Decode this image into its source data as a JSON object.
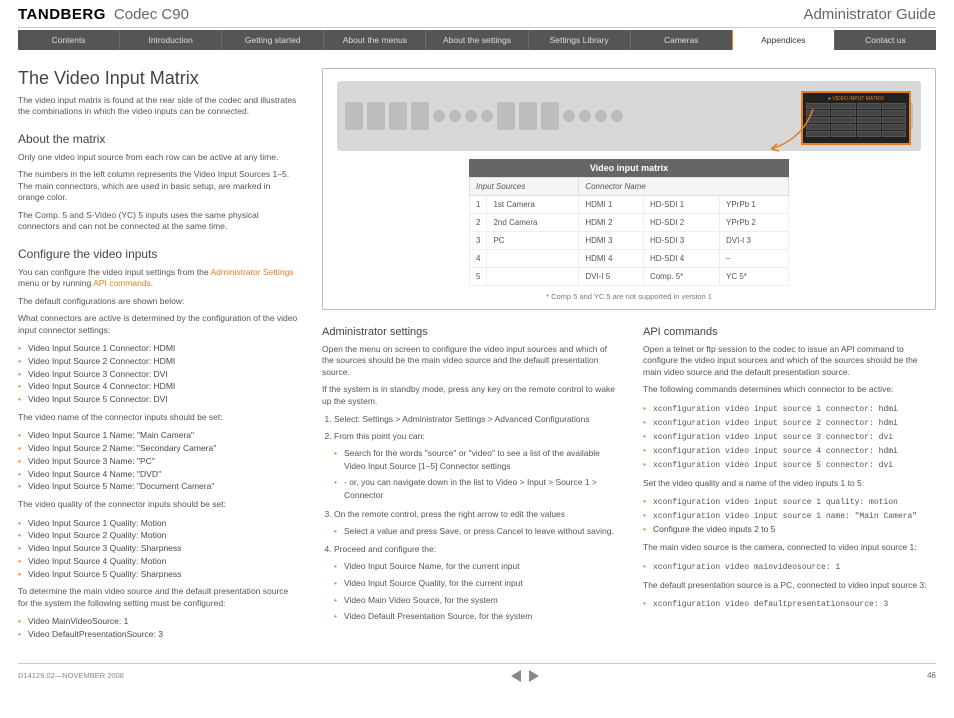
{
  "header": {
    "brand": "TANDBERG",
    "model": "Codec C90",
    "guide": "Administrator Guide"
  },
  "nav": [
    "Contents",
    "Introduction",
    "Getting started",
    "About the menus",
    "About the settings",
    "Settings Library",
    "Cameras",
    "Appendices",
    "Contact us"
  ],
  "nav_active": "Appendices",
  "page": {
    "title": "The Video Input Matrix",
    "intro": "The video input matrix is found at the rear side of the codec and illustrates the combinations in which the video inputs can be connected.",
    "about_h": "About the matrix",
    "about_p1": "Only one video input source from each row can be active at any time.",
    "about_p2": "The numbers in the left column represents the Video Input Sources 1–5. The main connectors, which are used in basic setup, are marked in orange color.",
    "about_p3": "The Comp. 5 and S-Video (YC) 5 inputs uses the same physical connectors and can not be connected at the same time.",
    "config_h": "Configure the video inputs",
    "config_p1_a": "You can configure the video input settings from the ",
    "config_p1_link1": "Administrator Settings",
    "config_p1_b": " menu or by running ",
    "config_p1_link2": "API commands",
    "config_p1_c": ".",
    "config_p2": "The default configurations are shown below:",
    "config_p3": "What connectors are active is determined by the configuration of the video input connector settings:",
    "connectors": [
      "Video Input Source 1 Connector: HDMI",
      "Video Input Source 2 Connector: HDMI",
      "Video Input Source 3 Connector: DVI",
      "Video Input Source 4 Connector: HDMI",
      "Video Input Source 5 Connector: DVI"
    ],
    "names_intro": "The video name of the connector inputs should be set:",
    "names": [
      "Video Input Source 1 Name: \"Main Camera\"",
      "Video Input Source 2 Name: \"Secondary Camera\"",
      "Video Input Source 3 Name: \"PC\"",
      "Video Input Source 4 Name: \"DVD\"",
      "Video Input Source 5 Name: \"Document Camera\""
    ],
    "quality_intro": "The video quality of the connector inputs should be set:",
    "quality": [
      "Video Input Source 1 Quality: Motion",
      "Video Input Source 2 Quality: Motion",
      "Video Input Source 3 Quality: Sharpness",
      "Video Input Source 4 Quality: Motion",
      "Video Input Source 5 Quality: Sharpness"
    ],
    "determine_intro": "To determine the main video source and the default presentation source for the system the following setting must be configured:",
    "determine": [
      "Video MainVideoSource: 1",
      "Video DefaultPresentationSource: 3"
    ]
  },
  "matrix": {
    "title": "Video input matrix",
    "col1": "Input Sources",
    "col2": "Connector Name",
    "rows": [
      {
        "n": "1",
        "src": "1st Camera",
        "c1": "HDMI 1",
        "c2": "HD-SDI 1",
        "c3": "YPrPb 1",
        "hl": true
      },
      {
        "n": "2",
        "src": "2nd Camera",
        "c1": "HDMI 2",
        "c2": "HD-SDI 2",
        "c3": "YPrPb 2",
        "hl": false
      },
      {
        "n": "3",
        "src": "PC",
        "c1": "HDMI 3",
        "c2": "HD-SDI 3",
        "c3": "DVI-I 3",
        "hl": true,
        "hl3": true
      },
      {
        "n": "4",
        "src": "",
        "c1": "HDMI 4",
        "c2": "HD-SDI 4",
        "c3": "–",
        "hl": false
      },
      {
        "n": "5",
        "src": "",
        "c1": "DVI-I 5",
        "c2": "Comp. 5*",
        "c3": "YC 5*",
        "hl": false
      }
    ],
    "footnote": "* Comp 5 and YC 5  are not supported in version 1"
  },
  "admin": {
    "h": "Administrator settings",
    "p1": "Open the menu on screen to configure the video input sources and which of the sources should be the main video source and the default presentation source.",
    "p2": "If the system is in standby mode, press any key on the remote control to wake up the system.",
    "steps": {
      "s1": "Select: Settings > Administrator Settings > Advanced Configurations",
      "s2": "From this point you can:",
      "s2a": "Search for the words \"source\" or \"video\" to see a list of the available Video Input Source [1–5] Connector settings",
      "s2b": "- or, you can navigate down in the list to Video > Input > Source 1 > Connector",
      "s3": "On the remote control, press the right arrow to edit the values",
      "s3a": "Select a value and press Save, or press Cancel to leave without saving.",
      "s4": "Proceed and configure the:",
      "s4list": [
        "Video Input Source Name, for the current input",
        "Video Input Source Quality, for the current input",
        "Video Main Video Source, for the system",
        "Video Default Presentation Source, for the system"
      ]
    }
  },
  "api": {
    "h": "API commands",
    "p1": "Open a telnet or ftp session to the codec to issue an API command to configure the video input sources and which of the sources should be the main video source and the default presentation source.",
    "p2": "The following commands determines which connector to be active:",
    "cmds1": [
      "xconfiguration video input source 1 connector: hdmi",
      "xconfiguration video input source 2 connector: hdmi",
      "xconfiguration video input source 3 connector: dvi",
      "xconfiguration video input source 4 connector: hdmi",
      "xconfiguration video input source 5 connector: dvi"
    ],
    "p3": "Set the video quality and a name of the video inputs 1 to 5:",
    "cmds2": [
      "xconfiguration video input source 1 quality: motion",
      "xconfiguration video input source 1 name: \"Main Camera\""
    ],
    "cmds2_extra": "Configure the video inputs 2 to 5",
    "p4": "The main video source is the camera, connected to video input source 1:",
    "cmds3": [
      "xconfiguration video mainvideosource: 1"
    ],
    "p5": "The default presentation source is a PC, connected to video input source 3:",
    "cmds4": [
      "xconfiguration video defaultpresentationsource: 3"
    ]
  },
  "footer": {
    "docid": "D14129.02—NOVEMBER 2008",
    "page": "46"
  }
}
